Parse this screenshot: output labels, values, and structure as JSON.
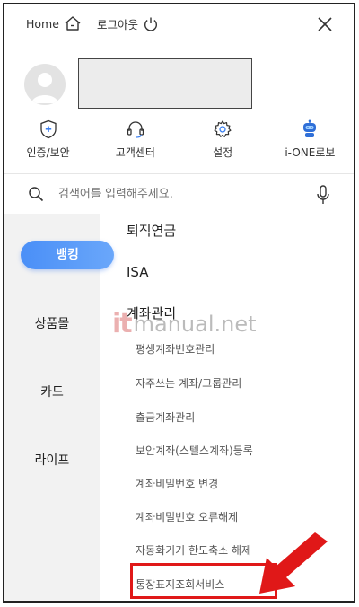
{
  "topbar": {
    "home_label": "Home",
    "logout_label": "로그아웃"
  },
  "quick_menu": [
    {
      "label": "인증/보안",
      "icon": "shield-plus-icon"
    },
    {
      "label": "고객센터",
      "icon": "headset-icon"
    },
    {
      "label": "설정",
      "icon": "gear-icon"
    },
    {
      "label": "i-ONE로보",
      "icon": "robot-icon"
    }
  ],
  "search": {
    "placeholder": "검색어를 입력해주세요."
  },
  "categories": [
    "뱅킹",
    "상품몰",
    "카드",
    "라이프"
  ],
  "menu": {
    "sections": [
      "퇴직연금",
      "ISA",
      "계좌관리"
    ],
    "items": [
      "평생계좌번호관리",
      "자주쓰는 계좌/그룹관리",
      "출금계좌관리",
      "보안계좌(스텔스계좌)등록",
      "계좌비밀번호 변경",
      "계좌비밀번호 오류해제",
      "자동화기기 한도축소 해제",
      "통장표지조회서비스"
    ]
  },
  "watermark": {
    "it": "it",
    "text": "manual.net"
  },
  "colors": {
    "accent": "#4a8ff7",
    "highlight": "#e01818"
  }
}
